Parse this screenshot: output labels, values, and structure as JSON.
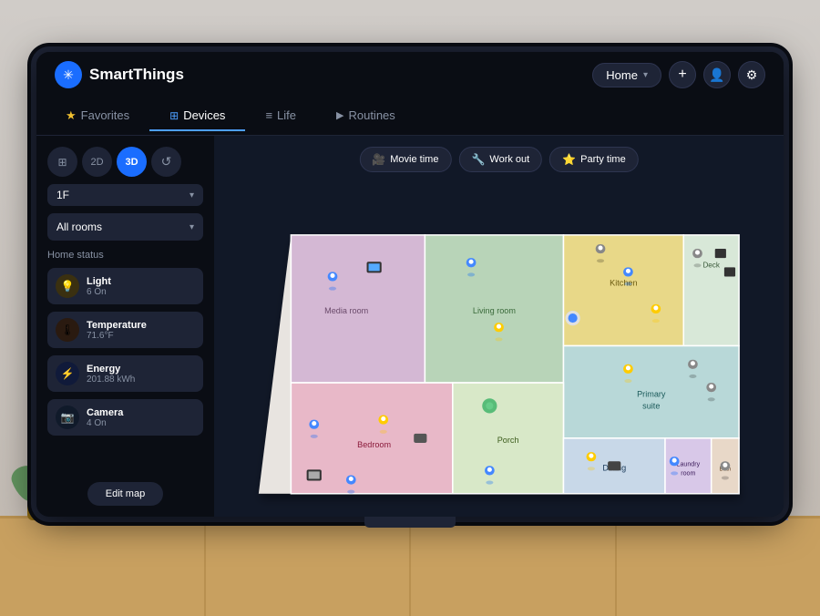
{
  "app": {
    "name": "SmartThings",
    "logo_symbol": "✳"
  },
  "header": {
    "home_selector": {
      "label": "Home",
      "dropdown_icon": "▾"
    },
    "add_icon": "+",
    "profile_icon": "👤",
    "settings_icon": "⚙"
  },
  "nav": {
    "tabs": [
      {
        "id": "favorites",
        "label": "Favorites",
        "icon": "★",
        "active": false
      },
      {
        "id": "devices",
        "label": "Devices",
        "icon": "⊞",
        "active": true
      },
      {
        "id": "life",
        "label": "Life",
        "icon": "≡",
        "active": false
      },
      {
        "id": "routines",
        "label": "Routines",
        "icon": "▶",
        "active": false
      }
    ]
  },
  "sidebar": {
    "view_buttons": [
      {
        "id": "grid",
        "label": "⊞",
        "active": false
      },
      {
        "id": "2d",
        "label": "2D",
        "active": false
      },
      {
        "id": "3d",
        "label": "3D",
        "active": true
      },
      {
        "id": "history",
        "label": "↺",
        "active": false
      }
    ],
    "floor": {
      "value": "1F",
      "dropdown_icon": "▾"
    },
    "room": {
      "value": "All rooms",
      "dropdown_icon": "▾"
    },
    "home_status_title": "Home status",
    "status_items": [
      {
        "id": "light",
        "icon": "💡",
        "type": "light",
        "label": "Light",
        "value": "6 On"
      },
      {
        "id": "temperature",
        "icon": "🌡",
        "type": "temp",
        "label": "Temperature",
        "value": "71.6°F"
      },
      {
        "id": "energy",
        "icon": "⚡",
        "type": "energy",
        "label": "Energy",
        "value": "201.88 kWh"
      },
      {
        "id": "camera",
        "icon": "📷",
        "type": "camera",
        "label": "Camera",
        "value": "4 On"
      }
    ],
    "edit_map_btn": "Edit map"
  },
  "map": {
    "scene_buttons": [
      {
        "id": "movie",
        "icon": "🎥",
        "label": "Movie time"
      },
      {
        "id": "workout",
        "icon": "🔧",
        "label": "Work out"
      },
      {
        "id": "party",
        "icon": "⭐",
        "label": "Party time"
      }
    ]
  }
}
